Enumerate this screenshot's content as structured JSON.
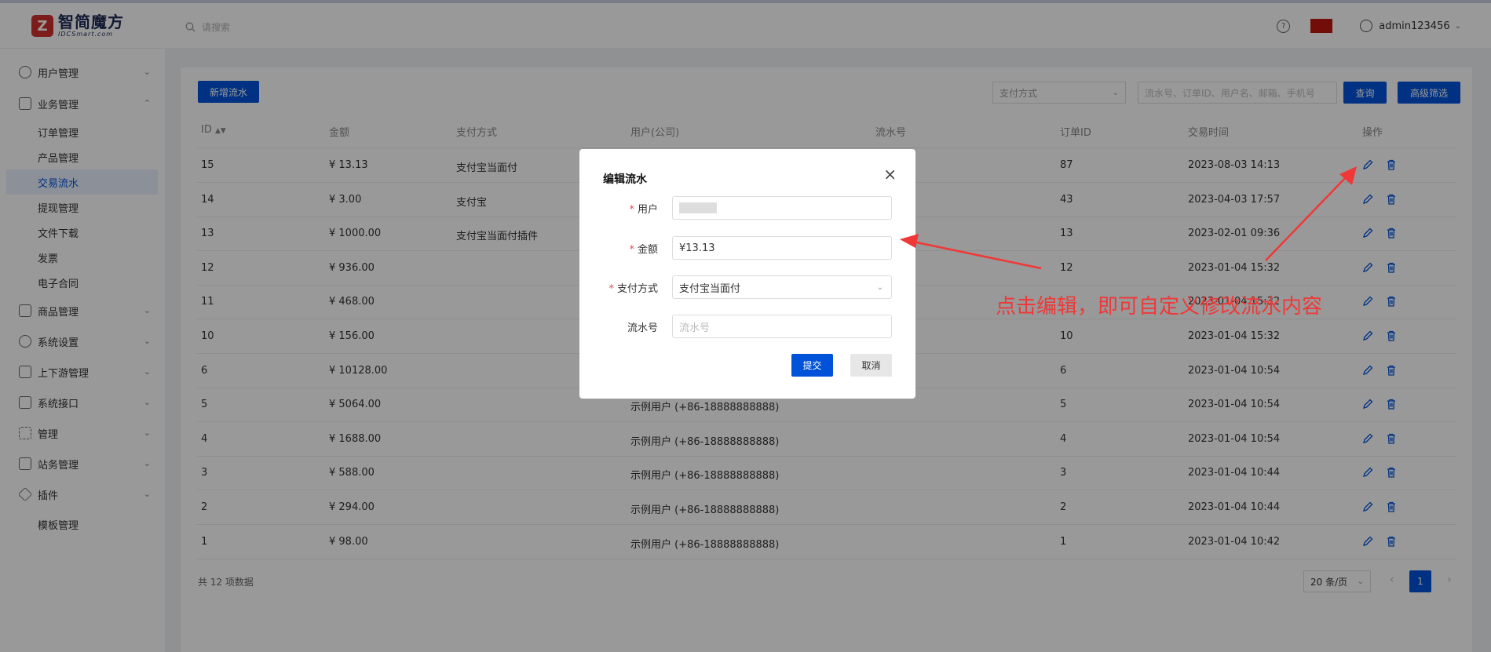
{
  "header": {
    "logo_cn": "智简魔方",
    "logo_en": "IDCSmart.com",
    "search_placeholder": "请搜索",
    "user": "admin123456"
  },
  "sidebar": {
    "menus": [
      {
        "label": "用户管理"
      },
      {
        "label": "业务管理"
      },
      {
        "label": "商品管理"
      },
      {
        "label": "系统设置"
      },
      {
        "label": "上下游管理"
      },
      {
        "label": "系统接口"
      },
      {
        "label": "管理"
      },
      {
        "label": "站务管理"
      },
      {
        "label": "插件"
      }
    ],
    "sub_items": [
      "订单管理",
      "产品管理",
      "交易流水",
      "提现管理",
      "文件下载",
      "发票",
      "电子合同"
    ],
    "plugin_sub": "模板管理"
  },
  "toolbar": {
    "add_button": "新增流水",
    "payment_select_placeholder": "支付方式",
    "search_placeholder": "流水号、订单ID、用户名、邮箱、手机号",
    "query_button": "查询",
    "advanced_button": "高级筛选"
  },
  "table": {
    "headers": [
      "ID",
      "金额",
      "支付方式",
      "用户(公司)",
      "流水号",
      "订单ID",
      "交易时间",
      "操作"
    ],
    "rows": [
      {
        "id": "15",
        "amount": "¥ 13.13",
        "method": "支付宝当面付",
        "user": "",
        "order": "87",
        "time": "2023-08-03 14:13"
      },
      {
        "id": "14",
        "amount": "¥ 3.00",
        "method": "支付宝",
        "user": "",
        "order": "43",
        "time": "2023-04-03 17:57"
      },
      {
        "id": "13",
        "amount": "¥ 1000.00",
        "method": "支付宝当面付插件",
        "user": "",
        "order": "13",
        "time": "2023-02-01 09:36"
      },
      {
        "id": "12",
        "amount": "¥ 936.00",
        "method": "",
        "user": "",
        "order": "12",
        "time": "2023-01-04 15:32"
      },
      {
        "id": "11",
        "amount": "¥ 468.00",
        "method": "",
        "user": "",
        "order": "",
        "time": "2023-01-04 15:32"
      },
      {
        "id": "10",
        "amount": "¥ 156.00",
        "method": "",
        "user": "",
        "order": "10",
        "time": "2023-01-04 15:32"
      },
      {
        "id": "6",
        "amount": "¥ 10128.00",
        "method": "",
        "user": "",
        "order": "6",
        "time": "2023-01-04 10:54"
      },
      {
        "id": "5",
        "amount": "¥ 5064.00",
        "method": "",
        "user": "示例用户 (+86-18888888888)",
        "order": "5",
        "time": "2023-01-04 10:54"
      },
      {
        "id": "4",
        "amount": "¥ 1688.00",
        "method": "",
        "user": "示例用户 (+86-18888888888)",
        "order": "4",
        "time": "2023-01-04 10:54"
      },
      {
        "id": "3",
        "amount": "¥ 588.00",
        "method": "",
        "user": "示例用户 (+86-18888888888)",
        "order": "3",
        "time": "2023-01-04 10:44"
      },
      {
        "id": "2",
        "amount": "¥ 294.00",
        "method": "",
        "user": "示例用户 (+86-18888888888)",
        "order": "2",
        "time": "2023-01-04 10:44"
      },
      {
        "id": "1",
        "amount": "¥ 98.00",
        "method": "",
        "user": "示例用户 (+86-18888888888)",
        "order": "1",
        "time": "2023-01-04 10:42"
      }
    ]
  },
  "pagination": {
    "total": "共 12 项数据",
    "page_size": "20 条/页",
    "current_page": "1"
  },
  "dialog": {
    "title": "编辑流水",
    "close": "×",
    "user_label": "用户",
    "amount_label": "金额",
    "amount_value": "¥13.13",
    "method_label": "支付方式",
    "method_value": "支付宝当面付",
    "serial_label": "流水号",
    "serial_placeholder": "流水号",
    "submit": "提交",
    "cancel": "取消",
    "required_mark": "*"
  },
  "annotation": {
    "text": "点击编辑，即可自定义修改流水内容",
    "color": "#f03838"
  },
  "colors": {
    "primary": "#0052d9",
    "active_bg": "#e8f0ff"
  }
}
